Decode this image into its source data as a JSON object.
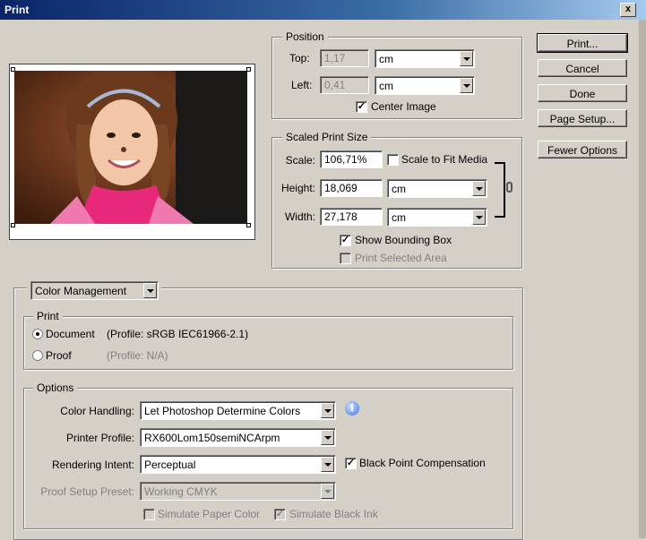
{
  "window": {
    "title": "Print",
    "close_glyph": "x"
  },
  "buttons": {
    "print": "Print...",
    "cancel": "Cancel",
    "done": "Done",
    "page_setup": "Page Setup...",
    "fewer_options": "Fewer Options"
  },
  "position": {
    "legend": "Position",
    "top_label": "Top:",
    "top_value": "1,17",
    "top_unit": "cm",
    "left_label": "Left:",
    "left_value": "0,41",
    "left_unit": "cm",
    "center_image_label": "Center Image",
    "center_image_checked": true
  },
  "scaled": {
    "legend": "Scaled Print Size",
    "scale_label": "Scale:",
    "scale_value": "106,71%",
    "fit_media_label": "Scale to Fit Media",
    "height_label": "Height:",
    "height_value": "18,069",
    "height_unit": "cm",
    "width_label": "Width:",
    "width_value": "27,178",
    "width_unit": "cm",
    "show_bounding_box_label": "Show Bounding Box",
    "show_bounding_box_checked": true,
    "print_selected_area_label": "Print Selected Area"
  },
  "color_mgmt": {
    "dropdown": "Color Management",
    "print_legend": "Print",
    "document_label": "Document",
    "document_profile": "(Profile: sRGB IEC61966-2.1)",
    "proof_label": "Proof",
    "proof_profile": "(Profile: N/A)",
    "options_legend": "Options",
    "color_handling_label": "Color Handling:",
    "color_handling_value": "Let Photoshop Determine Colors",
    "printer_profile_label": "Printer Profile:",
    "printer_profile_value": "RX600Lom150semiNCArpm",
    "rendering_intent_label": "Rendering Intent:",
    "rendering_intent_value": "Perceptual",
    "black_point_label": "Black Point Compensation",
    "proof_setup_label": "Proof Setup Preset:",
    "proof_setup_value": "Working CMYK",
    "simulate_paper_label": "Simulate Paper Color",
    "simulate_ink_label": "Simulate Black Ink",
    "info_glyph": "i"
  },
  "colors": {
    "dialog_bg": "#d4d0c8",
    "title_bar": "#0a246a",
    "sweater": "#e8287a"
  }
}
